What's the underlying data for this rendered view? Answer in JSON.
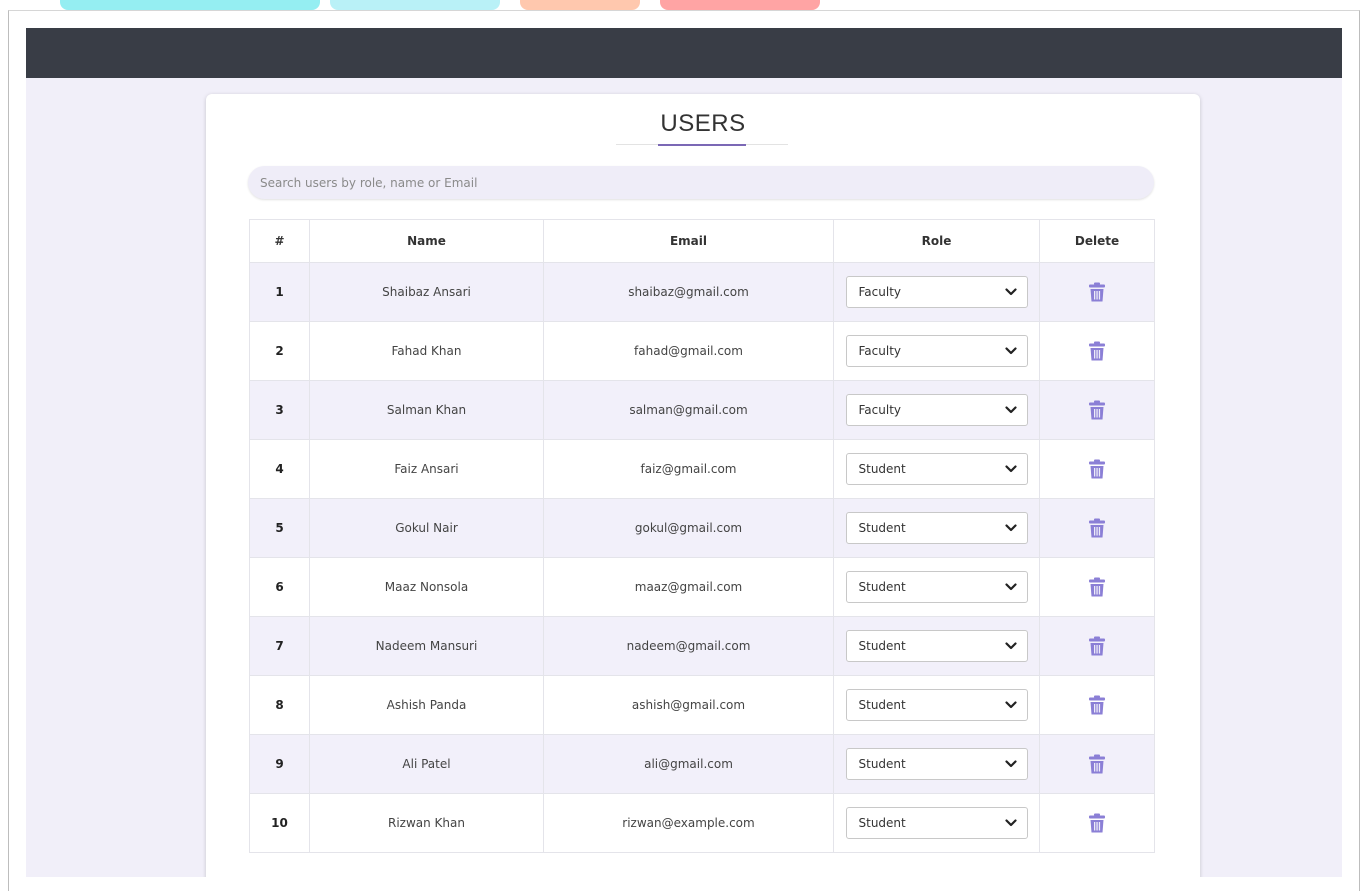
{
  "page": {
    "title": "USERS"
  },
  "search": {
    "placeholder": "Search users by role, name or Email",
    "value": ""
  },
  "table": {
    "headers": [
      "#",
      "Name",
      "Email",
      "Role",
      "Delete"
    ],
    "rows": [
      {
        "num": "1",
        "name": "Shaibaz Ansari",
        "email": "shaibaz@gmail.com",
        "role": "Faculty"
      },
      {
        "num": "2",
        "name": "Fahad Khan",
        "email": "fahad@gmail.com",
        "role": "Faculty"
      },
      {
        "num": "3",
        "name": "Salman Khan",
        "email": "salman@gmail.com",
        "role": "Faculty"
      },
      {
        "num": "4",
        "name": "Faiz Ansari",
        "email": "faiz@gmail.com",
        "role": "Student"
      },
      {
        "num": "5",
        "name": "Gokul Nair",
        "email": "gokul@gmail.com",
        "role": "Student"
      },
      {
        "num": "6",
        "name": "Maaz Nonsola",
        "email": "maaz@gmail.com",
        "role": "Student"
      },
      {
        "num": "7",
        "name": "Nadeem Mansuri",
        "email": "nadeem@gmail.com",
        "role": "Student"
      },
      {
        "num": "8",
        "name": "Ashish Panda",
        "email": "ashish@gmail.com",
        "role": "Student"
      },
      {
        "num": "9",
        "name": "Ali Patel",
        "email": "ali@gmail.com",
        "role": "Student"
      },
      {
        "num": "10",
        "name": "Rizwan Khan",
        "email": "rizwan@example.com",
        "role": "Student"
      }
    ]
  },
  "icons": {
    "delete": "trash-icon",
    "dropdown": "chevron-down-icon"
  },
  "colors": {
    "navbar": "#393d46",
    "page_background": "#f1eff9",
    "accent": "#7b68b5",
    "trash_icon": "#8b7fd6",
    "row_stripe": "#f2f0fa"
  }
}
